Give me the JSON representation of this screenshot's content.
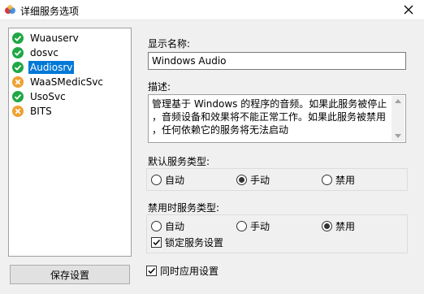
{
  "window": {
    "title": "详细服务选项"
  },
  "services": [
    {
      "name": "Wuauserv",
      "status": "ok",
      "selected": false
    },
    {
      "name": "dosvc",
      "status": "ok",
      "selected": false
    },
    {
      "name": "Audiosrv",
      "status": "ok",
      "selected": true
    },
    {
      "name": "WaaSMedicSvc",
      "status": "blocked",
      "selected": false
    },
    {
      "name": "UsoSvc",
      "status": "ok",
      "selected": false
    },
    {
      "name": "BITS",
      "status": "blocked",
      "selected": false
    }
  ],
  "buttons": {
    "save": "保存设置"
  },
  "detail": {
    "display_name_label": "显示名称:",
    "display_name_value": "Windows Audio",
    "description_label": "描述:",
    "description_line1": "管理基于 Windows 的程序的音频。如果此服务被停止",
    "description_line2": "，音频设备和效果将不能正常工作。如果此服务被禁用",
    "description_line3": "，任何依赖它的服务将无法启动"
  },
  "default_type": {
    "label": "默认服务类型:",
    "options": [
      "自动",
      "手动",
      "禁用"
    ],
    "selected": "手动"
  },
  "disabled_type": {
    "label": "禁用时服务类型:",
    "options": [
      "自动",
      "手动",
      "禁用"
    ],
    "selected": "禁用",
    "lock_label": "锁定服务设置",
    "lock_checked": true
  },
  "apply_all": {
    "label": "同时应用设置",
    "checked": true
  },
  "colors": {
    "ok": "#1fa845",
    "blocked": "#f0a030",
    "selection": "#0078d7"
  }
}
